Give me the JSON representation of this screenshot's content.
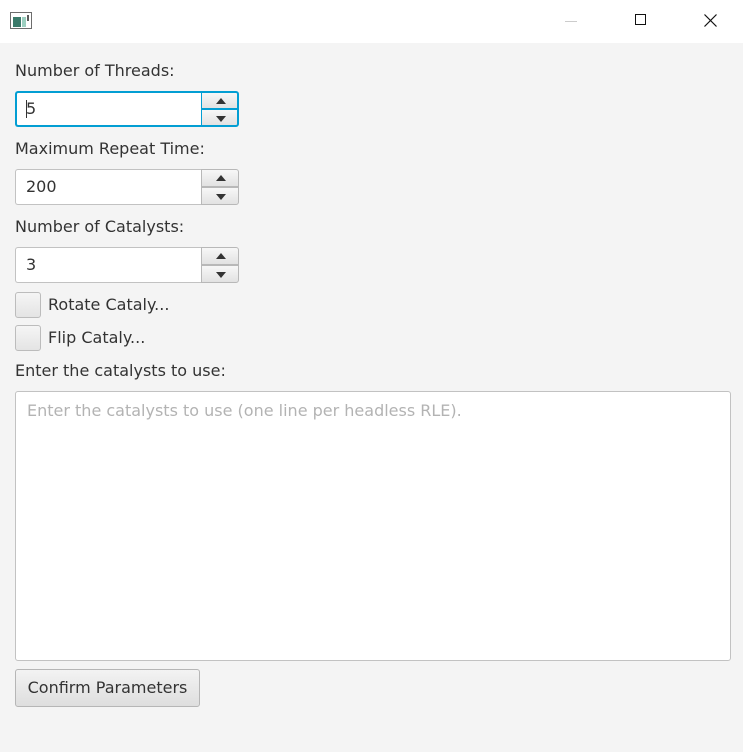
{
  "window": {
    "icon": "java-app-icon",
    "controls": {
      "minimize_icon": "minimize-icon",
      "maximize_icon": "maximize-icon",
      "close_icon": "close-icon"
    }
  },
  "form": {
    "threads": {
      "label": "Number of Threads:",
      "value": "5",
      "focused": true
    },
    "repeat_time": {
      "label": "Maximum Repeat Time:",
      "value": "200"
    },
    "catalysts_count": {
      "label": "Number of Catalysts:",
      "value": "3"
    },
    "rotate": {
      "label": "Rotate Cataly...",
      "checked": false
    },
    "flip": {
      "label": "Flip Cataly...",
      "checked": false
    },
    "catalysts_input": {
      "label": "Enter the catalysts to use:",
      "value": "",
      "placeholder": "Enter the catalysts to use (one line per headless RLE)."
    },
    "confirm_label": "Confirm Parameters"
  },
  "colors": {
    "background": "#f4f4f4",
    "focus": "#039ed3",
    "text": "#333333",
    "placeholder": "#b3b3b3"
  }
}
